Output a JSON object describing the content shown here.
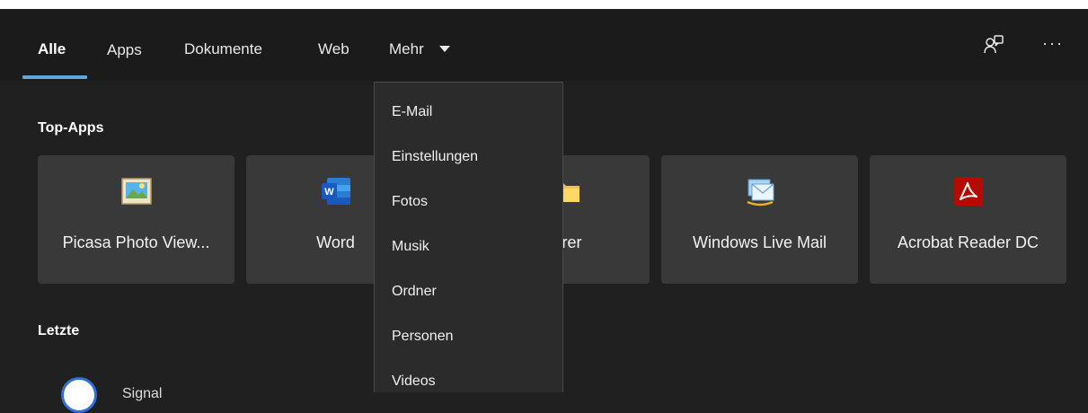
{
  "tabs": [
    {
      "label": "Alle",
      "active": true
    },
    {
      "label": "Apps"
    },
    {
      "label": "Dokumente"
    },
    {
      "label": "Web"
    },
    {
      "label": "Mehr"
    }
  ],
  "toolbar": {
    "feedback_icon": "feedback-person-icon",
    "more_label": "···"
  },
  "sections": {
    "top_apps": "Top-Apps",
    "recent": "Letzte"
  },
  "top_apps": [
    {
      "label": "Picasa Photo View...",
      "icon": "picasa-photo-viewer-icon"
    },
    {
      "label": "Word",
      "icon": "word-icon"
    },
    {
      "label": "Explorer",
      "icon": "folder-icon"
    },
    {
      "label": "Windows Live Mail",
      "icon": "windows-live-mail-icon"
    },
    {
      "label": "Acrobat Reader DC",
      "icon": "acrobat-reader-icon"
    }
  ],
  "mehr_menu": [
    "E-Mail",
    "Einstellungen",
    "Fotos",
    "Musik",
    "Ordner",
    "Personen",
    "Videos"
  ],
  "recent": [
    {
      "label": "Signal",
      "icon": "signal-icon"
    }
  ],
  "colors": {
    "accent": "#5ea6dd",
    "tile_bg": "#393939",
    "menu_bg": "#2b2b2b",
    "page_bg": "#202020"
  }
}
